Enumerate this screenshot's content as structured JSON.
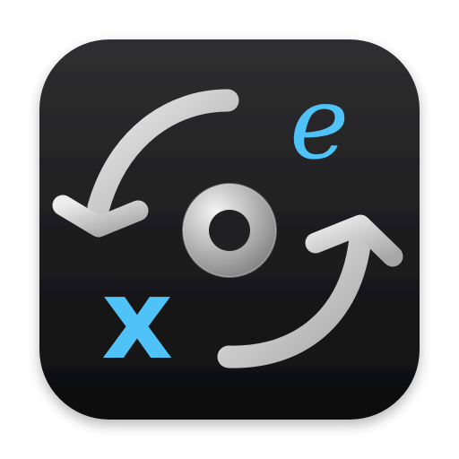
{
  "app_icon": {
    "letters": {
      "x": "x",
      "e": "e"
    },
    "icons": {
      "top_arrow": "curved-arrow-left-down-icon",
      "bottom_arrow": "curved-arrow-right-up-icon",
      "center": "ring-icon"
    },
    "colors": {
      "background_top": "#2f2f31",
      "background_bottom": "#0d0d0e",
      "accent": "#4fc3f7",
      "arrow_light": "#ececec",
      "arrow_dark": "#a7a7a7",
      "ring_light": "#f4f4f4",
      "ring_dark": "#7c7c7c"
    }
  }
}
